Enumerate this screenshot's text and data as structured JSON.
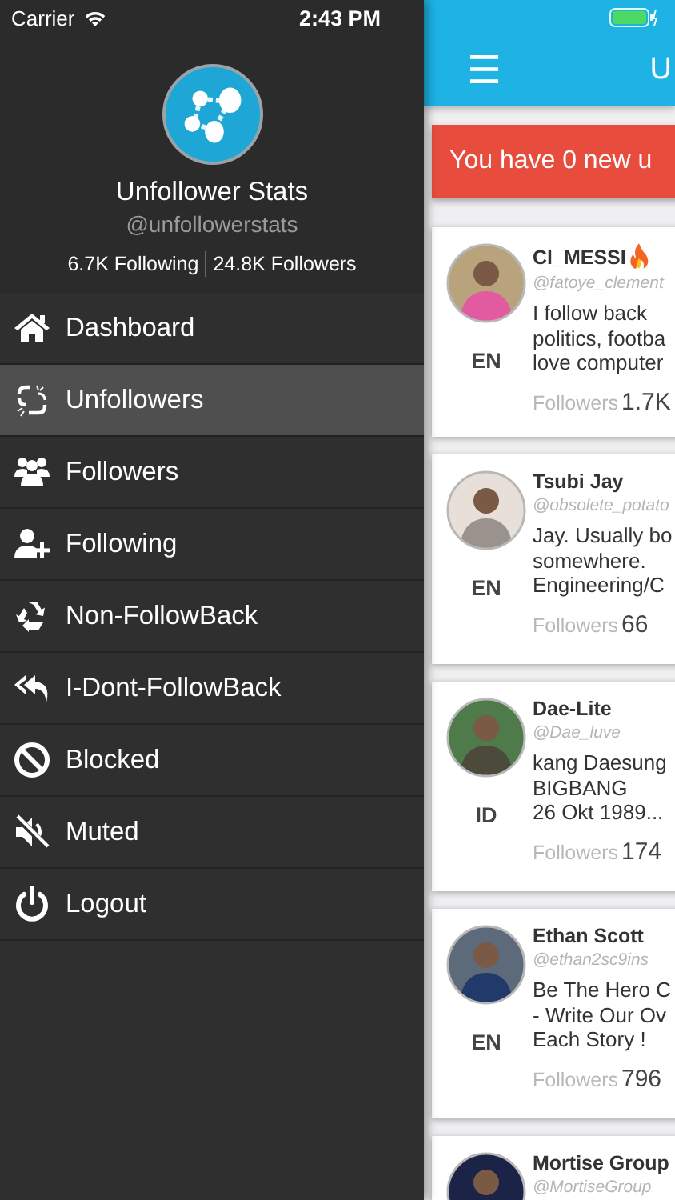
{
  "status_bar": {
    "carrier": "Carrier",
    "time": "2:43 PM"
  },
  "profile": {
    "name": "Unfollower Stats",
    "handle": "@unfollowerstats",
    "following": "6.7K Following",
    "followers": "24.8K Followers"
  },
  "menu": [
    {
      "label": "Dashboard",
      "selected": false
    },
    {
      "label": "Unfollowers",
      "selected": true
    },
    {
      "label": "Followers",
      "selected": false
    },
    {
      "label": "Following",
      "selected": false
    },
    {
      "label": "Non-FollowBack",
      "selected": false
    },
    {
      "label": "I-Dont-FollowBack",
      "selected": false
    },
    {
      "label": "Blocked",
      "selected": false
    },
    {
      "label": "Muted",
      "selected": false
    },
    {
      "label": "Logout",
      "selected": false
    }
  ],
  "top_bar": {
    "menu_glyph": "☰",
    "title": "U"
  },
  "banner": "You have 0 new u",
  "users": [
    {
      "name": "Cl_MESSI",
      "flame": true,
      "handle": "@fatoye_clement",
      "lang": "EN",
      "bio": [
        "I follow back",
        "politics, footba",
        "love computer"
      ],
      "followers_label": "Followers",
      "followers": "1.7K"
    },
    {
      "name": "Tsubi Jay",
      "flame": false,
      "handle": "@obsolete_potato",
      "lang": "EN",
      "bio": [
        "Jay. Usually bo",
        "somewhere.",
        "Engineering/C"
      ],
      "followers_label": "Followers",
      "followers": "66"
    },
    {
      "name": "Dae-Lite",
      "flame": false,
      "handle": "@Dae_luve",
      "lang": "ID",
      "bio": [
        "kang Daesung",
        "BIGBANG",
        "26 Okt 1989..."
      ],
      "followers_label": "Followers",
      "followers": "174"
    },
    {
      "name": "Ethan Scott",
      "flame": false,
      "handle": "@ethan2sc9ins",
      "lang": "EN",
      "bio": [
        "Be The Hero C",
        "- Write Our Ov",
        "Each  Story !"
      ],
      "followers_label": "Followers",
      "followers": "796"
    },
    {
      "name": "Mortise Group",
      "flame": false,
      "handle": "@MortiseGroup"
    }
  ]
}
